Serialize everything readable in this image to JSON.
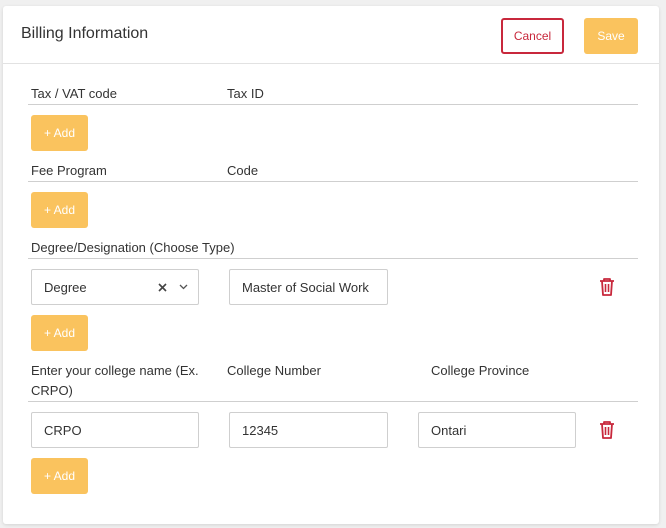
{
  "header": {
    "title": "Billing Information",
    "cancel_label": "Cancel",
    "save_label": "Save"
  },
  "tax": {
    "col1": "Tax / VAT code",
    "col2": "Tax ID",
    "add_label": "+ Add"
  },
  "fee": {
    "col1": "Fee Program",
    "col2": "Code",
    "add_label": "+ Add"
  },
  "degree": {
    "section_label": "Degree/Designation (Choose Type)",
    "type_value": "Degree",
    "designation_value": "Master of Social Work",
    "add_label": "+ Add"
  },
  "college": {
    "col1_line1": "Enter your college name (Ex.",
    "col1_line2": "CRPO)",
    "col2": "College Number",
    "col3": "College Province",
    "name_value": "CRPO",
    "number_value": "12345",
    "province_value": "Ontari",
    "add_label": "+ Add"
  },
  "icons": {
    "clear": "clear-icon",
    "chevron": "chevron-down-icon",
    "delete": "trash-icon"
  },
  "colors": {
    "accent": "#fac35e",
    "danger": "#c8283c"
  }
}
